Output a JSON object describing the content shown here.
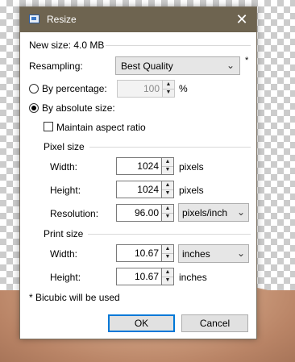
{
  "dialog": {
    "title": "Resize",
    "close_glyph": "✕"
  },
  "new_size": "New size: 4.0 MB",
  "resampling": {
    "label": "Resampling:",
    "value": "Best Quality",
    "asterisk": "*"
  },
  "by_percentage": {
    "label": "By percentage:",
    "value": "100",
    "unit": "%",
    "selected": false,
    "enabled": false
  },
  "by_absolute": {
    "label": "By absolute size:",
    "selected": true
  },
  "maintain_aspect": {
    "label": "Maintain aspect ratio",
    "checked": false
  },
  "pixel_size": {
    "group_label": "Pixel size",
    "width_label": "Width:",
    "width_value": "1024",
    "width_unit": "pixels",
    "height_label": "Height:",
    "height_value": "1024",
    "height_unit": "pixels",
    "resolution_label": "Resolution:",
    "resolution_value": "96.00",
    "resolution_unit": "pixels/inch"
  },
  "print_size": {
    "group_label": "Print size",
    "width_label": "Width:",
    "width_value": "10.67",
    "width_unit": "inches",
    "height_label": "Height:",
    "height_value": "10.67",
    "height_unit": "inches"
  },
  "footnote": "* Bicubic will be used",
  "buttons": {
    "ok": "OK",
    "cancel": "Cancel"
  },
  "icons": {
    "app": "resize-app-icon",
    "close": "close-icon",
    "chevron": "chevron-down-icon",
    "spin_up": "spin-up-icon",
    "spin_down": "spin-down-icon"
  },
  "colors": {
    "titlebar": "#6e6450",
    "default_button_border": "#0078d7"
  }
}
